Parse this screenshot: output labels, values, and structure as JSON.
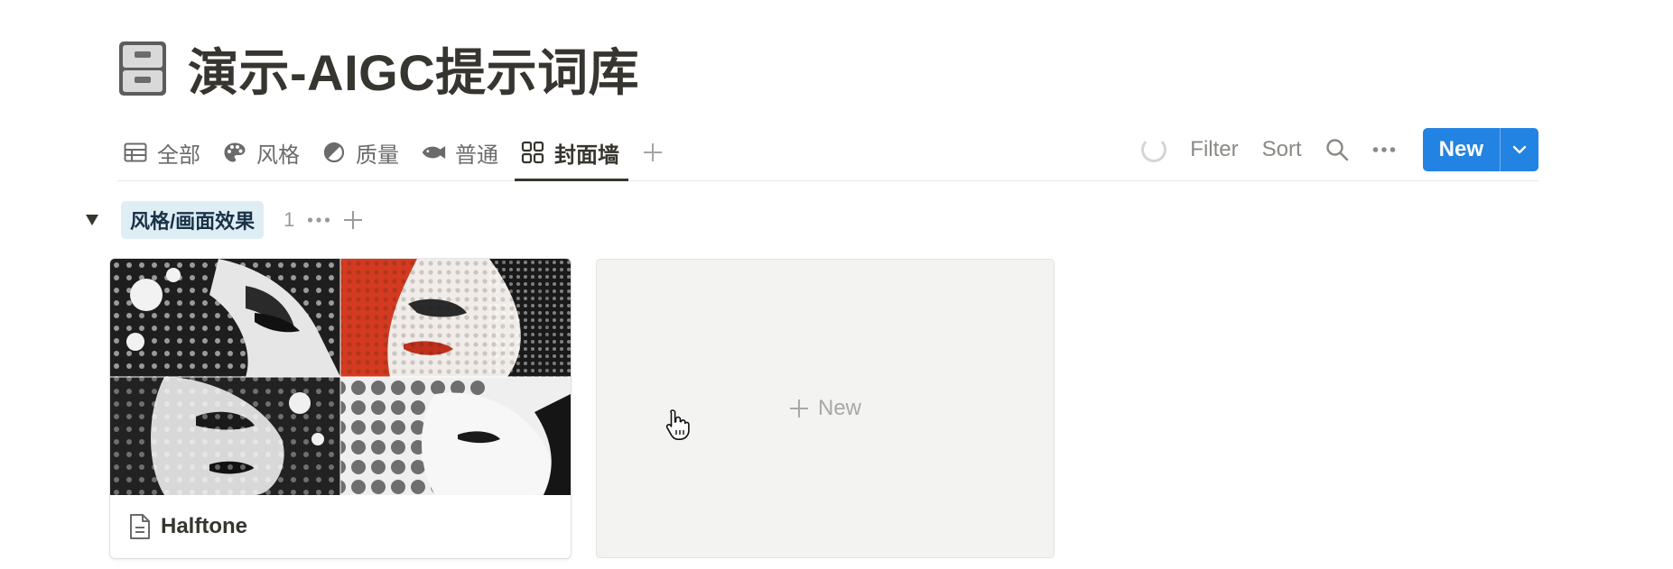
{
  "page": {
    "title": "演示-AIGC提示词库",
    "title_icon": "file-cabinet-icon"
  },
  "views": [
    {
      "label": "全部",
      "icon": "table-icon",
      "active": false
    },
    {
      "label": "风格",
      "icon": "palette-icon",
      "active": false
    },
    {
      "label": "质量",
      "icon": "contrast-icon",
      "active": false
    },
    {
      "label": "普通",
      "icon": "fish-icon",
      "active": false
    },
    {
      "label": "封面墙",
      "icon": "gallery-icon",
      "active": true
    }
  ],
  "toolbar": {
    "filter_label": "Filter",
    "sort_label": "Sort",
    "new_label": "New"
  },
  "group": {
    "label": "风格/画面效果",
    "count": "1",
    "tag_color": "#dfedf5"
  },
  "cards": [
    {
      "title": "Halftone",
      "icon": "page-icon",
      "cover": "halftone-portrait-collage"
    }
  ],
  "new_card": {
    "label": "New"
  },
  "colors": {
    "accent": "#2383e2",
    "text": "#37352f",
    "muted": "#8a8986"
  }
}
